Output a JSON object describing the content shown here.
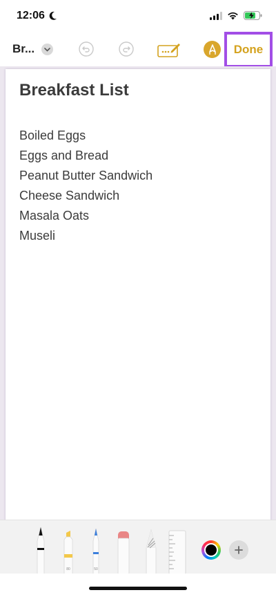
{
  "status_bar": {
    "time": "12:06",
    "icons": [
      "moon-icon",
      "cellular-signal-icon",
      "wifi-icon",
      "battery-charging-icon"
    ],
    "battery_color": "#34c759"
  },
  "toolbar": {
    "note_title_short": "Br...",
    "done_label": "Done",
    "accent_color": "#d4a21e",
    "highlight_color": "#a24ee6",
    "icons": [
      "chevron-down-icon",
      "undo-icon",
      "redo-icon",
      "markup-icon",
      "pen-circle-icon"
    ]
  },
  "note": {
    "heading": "Breakfast List",
    "items": [
      "Boiled Eggs",
      "Eggs and Bread",
      "Peanut Butter Sandwich",
      "Cheese Sandwich",
      "Masala Oats",
      "Museli"
    ]
  },
  "palette": {
    "tools": [
      "pen",
      "highlighter",
      "pencil-blue",
      "eraser",
      "pencil",
      "ruler"
    ],
    "highlighter_size": "80",
    "pencil_size": "50",
    "selected_color": "#000000",
    "icons": [
      "color-wheel-icon",
      "add-icon"
    ]
  }
}
